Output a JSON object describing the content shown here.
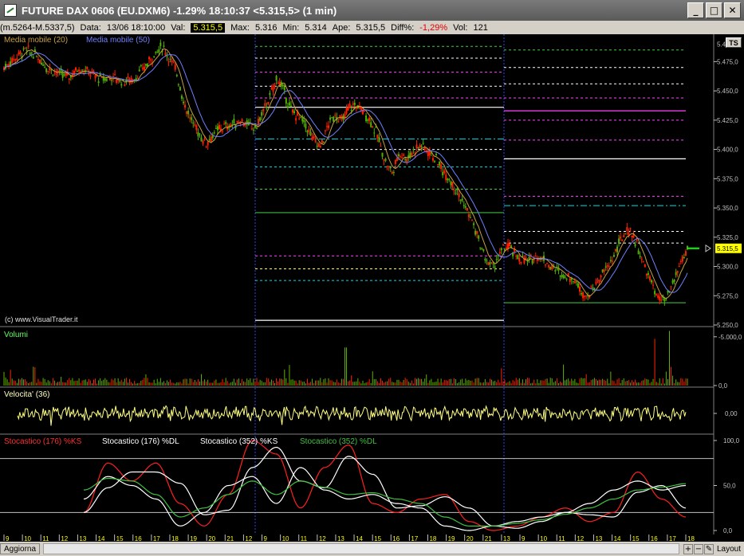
{
  "window": {
    "title": "FUTURE DAX 0606 (EU.DXM6) -1.29% 18:10:37 <5.315,5> (1 min)",
    "minimize": "_",
    "maximize": "□",
    "close": "✕"
  },
  "infobar": {
    "range": "(m.5264-M.5337,5)",
    "data_label": "Data:",
    "data_value": "13/06 18:10:00",
    "val_label": "Val:",
    "val_value": "5.315,5",
    "max_label": "Max:",
    "max_value": "5.316",
    "min_label": "Min:",
    "min_value": "5.314",
    "ape_label": "Ape:",
    "ape_value": "5.315,5",
    "diff_label": "Diff%:",
    "diff_value": "-1,29%",
    "vol_label": "Vol:",
    "vol_value": "121"
  },
  "price_panel": {
    "ma20_label": "Media mobile (20)",
    "ma50_label": "Media mobile (50)",
    "ts_button": "TS",
    "copyright": "(c) www.VisualTrader.it",
    "current_price_tag": "5.315,5"
  },
  "volume_panel": {
    "title": "Volumi",
    "ticks": [
      "5.000,0",
      "0,0"
    ]
  },
  "velocity_panel": {
    "title": "Velocita' (36)",
    "ticks": [
      "0,00"
    ]
  },
  "stoch_panel": {
    "labels": [
      "Stocastico (176) %KS",
      "Stocastico (176) %DL",
      "Stocastico (352) %KS",
      "Stocastico (352) %DL"
    ],
    "ticks": [
      "100,0",
      "50,0",
      "0,0"
    ]
  },
  "statusbar": {
    "tab": "Aggiorna",
    "plus": "+",
    "minus": "−",
    "pencil": "✎",
    "layout": "Layout"
  },
  "colors": {
    "ma20": "#c8a040",
    "ma50": "#6f7fff",
    "stoch176ks": "#ff2020",
    "stoch176dl": "#ffffff",
    "stoch352ks": "#ffffff",
    "stoch352dl": "#40c040",
    "velocity": "#ffff80",
    "volume_up": "#60b000",
    "volume_down": "#ff2000"
  },
  "chart_data": {
    "type": "line",
    "price_axis": [
      "5.475,0",
      "5.450,0",
      "5.425,0",
      "5.400,0",
      "5.375,0",
      "5.350,0",
      "5.325,0",
      "5.300,0",
      "5.275,0",
      "5.250,0"
    ],
    "price_axis_top_partial": "5.4",
    "ylim": [
      5250,
      5495
    ],
    "x_labels": [
      "9",
      "10",
      "11",
      "12",
      "13",
      "14",
      "15",
      "16",
      "17",
      "18",
      "19",
      "20",
      "21",
      "12",
      "9",
      "10",
      "11",
      "12",
      "13",
      "14",
      "15",
      "16",
      "17",
      "18",
      "19",
      "20",
      "21",
      "13",
      "9",
      "10",
      "11",
      "12",
      "13",
      "14",
      "15",
      "16",
      "17",
      "18"
    ],
    "day_separators": [
      "12",
      "13"
    ],
    "price_path": [
      [
        0,
        5470
      ],
      [
        3,
        5478
      ],
      [
        6,
        5485
      ],
      [
        9,
        5480
      ],
      [
        12,
        5470
      ],
      [
        15,
        5465
      ],
      [
        18,
        5462
      ],
      [
        21,
        5470
      ],
      [
        24,
        5465
      ],
      [
        27,
        5460
      ],
      [
        30,
        5462
      ],
      [
        33,
        5458
      ],
      [
        36,
        5460
      ],
      [
        39,
        5470
      ],
      [
        42,
        5482
      ],
      [
        44,
        5488
      ],
      [
        46,
        5478
      ],
      [
        48,
        5466
      ],
      [
        50,
        5440
      ],
      [
        52,
        5425
      ],
      [
        54,
        5415
      ],
      [
        56,
        5405
      ],
      [
        58,
        5412
      ],
      [
        60,
        5418
      ],
      [
        62,
        5420
      ],
      [
        64,
        5422
      ],
      [
        66,
        5425
      ],
      [
        68,
        5420
      ],
      [
        70,
        5418
      ],
      [
        72,
        5432
      ],
      [
        74,
        5445
      ],
      [
        76,
        5462
      ],
      [
        78,
        5448
      ],
      [
        80,
        5432
      ],
      [
        82,
        5428
      ],
      [
        84,
        5420
      ],
      [
        86,
        5408
      ],
      [
        88,
        5402
      ],
      [
        90,
        5420
      ],
      [
        92,
        5430
      ],
      [
        94,
        5424
      ],
      [
        96,
        5436
      ],
      [
        98,
        5438
      ],
      [
        100,
        5432
      ],
      [
        102,
        5424
      ],
      [
        104,
        5410
      ],
      [
        106,
        5390
      ],
      [
        108,
        5380
      ],
      [
        110,
        5398
      ],
      [
        112,
        5392
      ],
      [
        114,
        5400
      ],
      [
        116,
        5404
      ],
      [
        118,
        5398
      ],
      [
        120,
        5392
      ],
      [
        122,
        5382
      ],
      [
        124,
        5375
      ],
      [
        126,
        5364
      ],
      [
        128,
        5352
      ],
      [
        130,
        5340
      ],
      [
        132,
        5322
      ],
      [
        134,
        5305
      ],
      [
        136,
        5300
      ],
      [
        138,
        5312
      ],
      [
        140,
        5318
      ],
      [
        142,
        5310
      ],
      [
        144,
        5306
      ],
      [
        146,
        5304
      ],
      [
        148,
        5310
      ],
      [
        150,
        5306
      ],
      [
        152,
        5300
      ],
      [
        154,
        5296
      ],
      [
        156,
        5292
      ],
      [
        158,
        5290
      ],
      [
        160,
        5282
      ],
      [
        162,
        5274
      ],
      [
        164,
        5282
      ],
      [
        166,
        5292
      ],
      [
        168,
        5300
      ],
      [
        170,
        5312
      ],
      [
        172,
        5326
      ],
      [
        174,
        5332
      ],
      [
        176,
        5318
      ],
      [
        178,
        5300
      ],
      [
        180,
        5286
      ],
      [
        182,
        5272
      ],
      [
        184,
        5270
      ],
      [
        186,
        5286
      ],
      [
        188,
        5302
      ],
      [
        190,
        5315
      ]
    ],
    "volume_spikes": [
      {
        "x": 95,
        "v": 3900
      },
      {
        "x": 181,
        "v": 4800
      },
      {
        "x": 185,
        "v": 5600
      }
    ],
    "levels": [
      {
        "price": 5436,
        "color": "#ffffff",
        "style": "solid",
        "segment": "mid"
      },
      {
        "price": 5409,
        "color": "#00e0e0",
        "style": "dashdot",
        "segment": "mid"
      },
      {
        "price": 5346,
        "color": "#3cb83c",
        "style": "solid",
        "segment": "mid"
      },
      {
        "price": 5309,
        "color": "#ff44ff",
        "style": "dashed",
        "segment": "mid"
      },
      {
        "price": 5298,
        "color": "#ffff44",
        "style": "dashed",
        "segment": "mid"
      },
      {
        "price": 5288,
        "color": "#00e0e0",
        "style": "dashed",
        "segment": "mid"
      },
      {
        "price": 5254,
        "color": "#ffffff",
        "style": "solid",
        "segment": "mid"
      },
      {
        "price": 5392,
        "color": "#ffffff",
        "style": "solid",
        "segment": "right"
      },
      {
        "price": 5352,
        "color": "#00e0e0",
        "style": "dashdot",
        "segment": "right"
      },
      {
        "price": 5433,
        "color": "#ff44ff",
        "style": "solid",
        "segment": "right"
      },
      {
        "price": 5269,
        "color": "#3cb83c",
        "style": "solid",
        "segment": "right"
      }
    ]
  }
}
